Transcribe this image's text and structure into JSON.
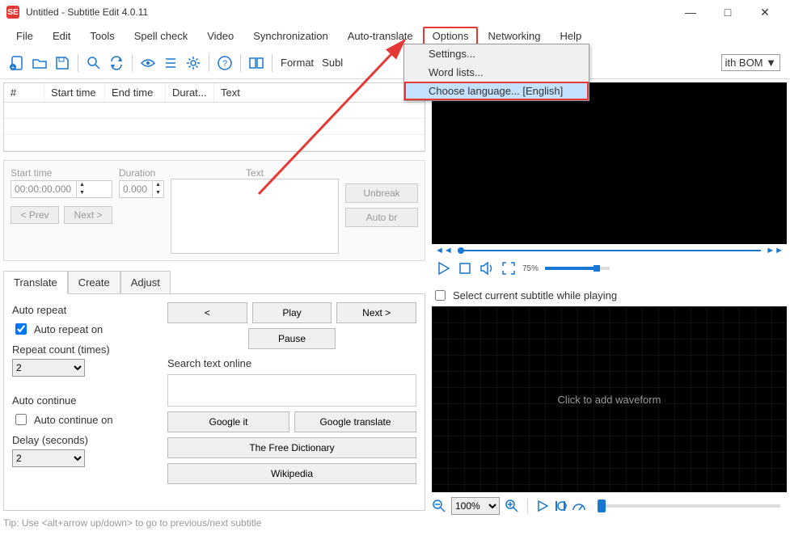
{
  "app_icon_text": "SE",
  "title": "Untitled - Subtitle Edit 4.0.11",
  "win": {
    "min": "—",
    "max": "□",
    "close": "✕"
  },
  "menu": {
    "file": "File",
    "edit": "Edit",
    "tools": "Tools",
    "spell": "Spell check",
    "video": "Video",
    "sync": "Synchronization",
    "auto": "Auto-translate",
    "options": "Options",
    "net": "Networking",
    "help": "Help"
  },
  "dropdown": {
    "settings": "Settings...",
    "wordlists": "Word lists...",
    "lang": "Choose language... [English]"
  },
  "toolbar": {
    "format_label": "Format",
    "format_value": "Subl",
    "encoding_value": "ith BOM  ▼"
  },
  "table": {
    "num": "#",
    "start": "Start time",
    "end": "End time",
    "dur": "Durat...",
    "text": "Text"
  },
  "edit": {
    "start_label": "Start time",
    "start_value": "00:00:00.000",
    "dur_label": "Duration",
    "dur_value": "0.000",
    "text_label": "Text",
    "unbreak": "Unbreak",
    "autobr": "Auto br",
    "prev": "< Prev",
    "next": "Next >"
  },
  "tabs": {
    "translate": "Translate",
    "create": "Create",
    "adjust": "Adjust"
  },
  "panel": {
    "auto_repeat": "Auto repeat",
    "auto_repeat_on": "Auto repeat on",
    "repeat_count": "Repeat count (times)",
    "repeat_value": "2",
    "auto_continue": "Auto continue",
    "auto_continue_on": "Auto continue on",
    "delay": "Delay (seconds)",
    "delay_value": "2",
    "back": "<",
    "play": "Play",
    "next": "Next >",
    "pause": "Pause",
    "search_label": "Search text online",
    "google_it": "Google it",
    "google_tr": "Google translate",
    "freedict": "The Free Dictionary",
    "wiki": "Wikipedia"
  },
  "tip": "Tip: Use <alt+arrow up/down> to go to previous/next subtitle",
  "video": {
    "vol": "75%"
  },
  "wave": {
    "check_label": "Select current subtitle while playing",
    "placeholder": "Click to add waveform",
    "zoom": "100%"
  }
}
